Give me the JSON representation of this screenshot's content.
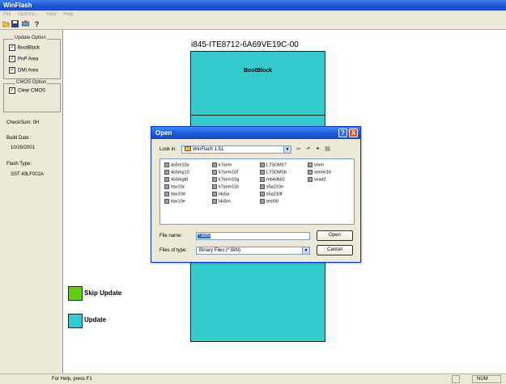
{
  "app": {
    "title": "WinFlash"
  },
  "menu": {
    "items": [
      "File",
      "Options...",
      "View",
      "Help"
    ]
  },
  "toolbar": {
    "icons": [
      "open-icon",
      "save-icon",
      "flash-icon",
      "help-icon"
    ]
  },
  "sidebar": {
    "update_group": {
      "title": "Update Option",
      "options": [
        {
          "label": "BootBlock",
          "checked": true
        },
        {
          "label": "PnP Area",
          "checked": true
        },
        {
          "label": "DMI Area",
          "checked": true
        }
      ]
    },
    "cmos_group": {
      "title": "CMOS Option",
      "options": [
        {
          "label": "Clear CMOS",
          "checked": true
        }
      ]
    },
    "checksum": "CheckSum:  0H",
    "build_date_label": "Build Date :",
    "build_date": "10/29/2001",
    "flash_type_label": "Flash Type:",
    "flash_type": "SST 49LF002A"
  },
  "main": {
    "bios_id": "i845-ITE8712-6A69VE19C-00",
    "block_label": "BootBlock",
    "legend": [
      {
        "label": "Skip Update",
        "color": "#66cc11"
      },
      {
        "label": "Update",
        "color": "#33cccc"
      }
    ]
  },
  "dialog": {
    "title": "Open",
    "help_btn": "?",
    "close_btn": "X",
    "look_in_label": "Look in:",
    "look_in_value": "WinFlash 1.51",
    "files": [
      [
        "4s5m10a",
        "4s5mg10",
        "4s5mgtd",
        "itav10c",
        "itav10d",
        "itav10e"
      ],
      [
        "k7sem",
        "k7sem10f",
        "k7sem10g",
        "k7sem11b",
        "l4s5a",
        "l4s5m"
      ],
      [
        "L7SOM17",
        "L7SOM18",
        "mb4db02",
        "s5a210e",
        "s5a210f",
        "test00"
      ],
      [
        "vmm",
        "vmmv10",
        "vxad2"
      ]
    ],
    "file_name_label": "File name:",
    "file_name_value": "*.BIN",
    "file_type_label": "Files of type:",
    "file_type_value": "Binary Files (*.BIN)",
    "open_btn": "Open",
    "cancel_btn": "Cancel"
  },
  "status": {
    "help_text": "For Help, press F1",
    "num": "NUM"
  }
}
